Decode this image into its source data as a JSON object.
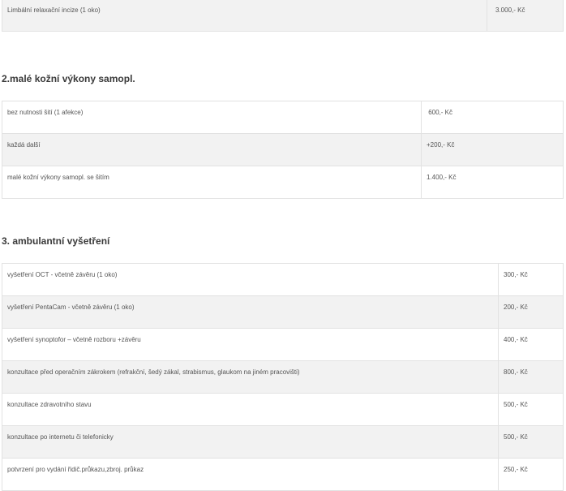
{
  "section1": {
    "rows": [
      {
        "name": "Limbální relaxační incize (1 oko)",
        "price": "3.000,- Kč"
      }
    ]
  },
  "section2": {
    "title": "2.malé kožní výkony samopl.",
    "rows": [
      {
        "name": "bez nutnosti šití (1 afekce)",
        "price": " 600,- Kč"
      },
      {
        "name": "každá další",
        "price": "+200,- Kč"
      },
      {
        "name": "malé kožní výkony samopl. se šitím",
        "price": "1.400,- Kč"
      }
    ]
  },
  "section3": {
    "title": "3. ambulantní vyšetření",
    "rows": [
      {
        "name": "vyšetření OCT - včetně závěru (1 oko)",
        "price": "300,- Kč"
      },
      {
        "name": "vyšetření PentaCam - včetně závěru (1 oko)",
        "price": "200,- Kč"
      },
      {
        "name": "vyšetření synoptofor – včetně rozboru +závěru",
        "price": "400,- Kč"
      },
      {
        "name": "konzultace před operačním zákrokem (refrakční, šedý zákal, strabismus, glaukom na jiném pracovišti)",
        "price": "800,- Kč"
      },
      {
        "name": "konzultace zdravotního stavu",
        "price": "500,- Kč"
      },
      {
        "name": "konzultace po internetu či telefonicky",
        "price": "500,- Kč"
      },
      {
        "name": "potvrzení pro vydání řidič.průkazu,zbroj. průkaz",
        "price": "250,- Kč"
      }
    ]
  }
}
